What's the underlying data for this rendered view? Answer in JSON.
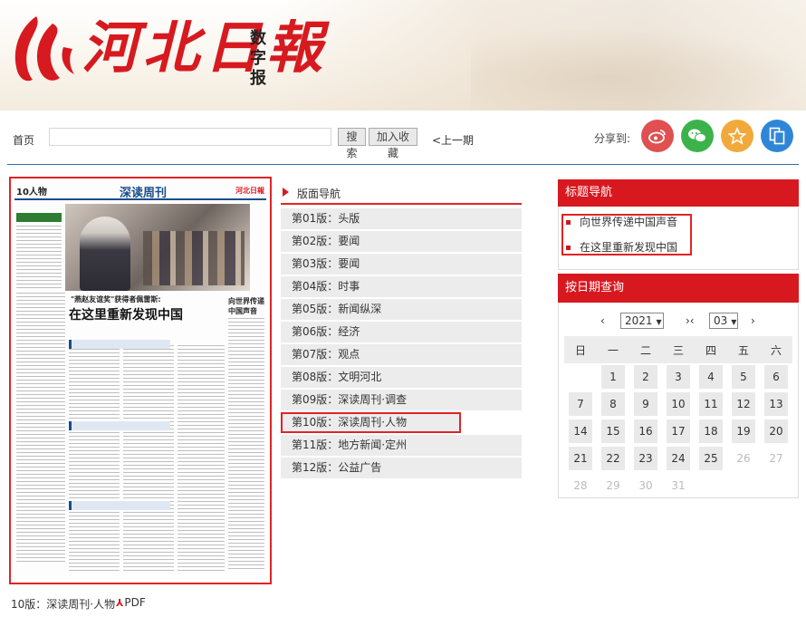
{
  "header": {
    "logo_text": "河北日報",
    "logo_sub": "数字报"
  },
  "toolbar": {
    "home": "首页",
    "search_value": "",
    "search_btn": "搜索",
    "fav_btn": "加入收藏",
    "prev": "<上一期",
    "share_label": "分享到:"
  },
  "share": {
    "icons": [
      "weibo-icon",
      "wechat-icon",
      "star-icon",
      "copy-icon"
    ]
  },
  "paper": {
    "page_no": "10人物",
    "section": "深读周刊",
    "logo": "河北日報",
    "kicker": "\"燕赵友谊奖\"获得者佩雷斯:",
    "headline": "在这里重新发现中国",
    "side_title": "向世界传递中国声音"
  },
  "edition_nav": {
    "title": "版面导航",
    "items": [
      "第01版：头版",
      "第02版：要闻",
      "第03版：要闻",
      "第04版：时事",
      "第05版：新闻纵深",
      "第06版：经济",
      "第07版：观点",
      "第08版：文明河北",
      "第09版：深读周刊·调查",
      "第10版：深读周刊·人物",
      "第11版：地方新闻·定州",
      "第12版：公益广告"
    ]
  },
  "title_nav": {
    "title": "标题导航",
    "items": [
      "向世界传递中国声音",
      "在这里重新发现中国"
    ]
  },
  "date_search": {
    "title": "按日期查询",
    "prev": "‹",
    "year": "2021",
    "mid": "›‹",
    "month": "03",
    "next": "›",
    "weekdays": [
      "日",
      "一",
      "二",
      "三",
      "四",
      "五",
      "六"
    ],
    "weeks": [
      [
        "",
        "1",
        "2",
        "3",
        "4",
        "5",
        "6"
      ],
      [
        "7",
        "8",
        "9",
        "10",
        "11",
        "12",
        "13"
      ],
      [
        "14",
        "15",
        "16",
        "17",
        "18",
        "19",
        "20"
      ],
      [
        "21",
        "22",
        "23",
        "24",
        "25",
        "26",
        "27"
      ],
      [
        "28",
        "29",
        "30",
        "31",
        "",
        "",
        ""
      ]
    ],
    "last_active_day": "25"
  },
  "footer": {
    "label": "10版：深读周刊·人物",
    "pdf": "PDF"
  },
  "colors": {
    "brand_red": "#d8181f",
    "highlight_red": "#e02424",
    "divider_blue": "#2a6fb0"
  }
}
